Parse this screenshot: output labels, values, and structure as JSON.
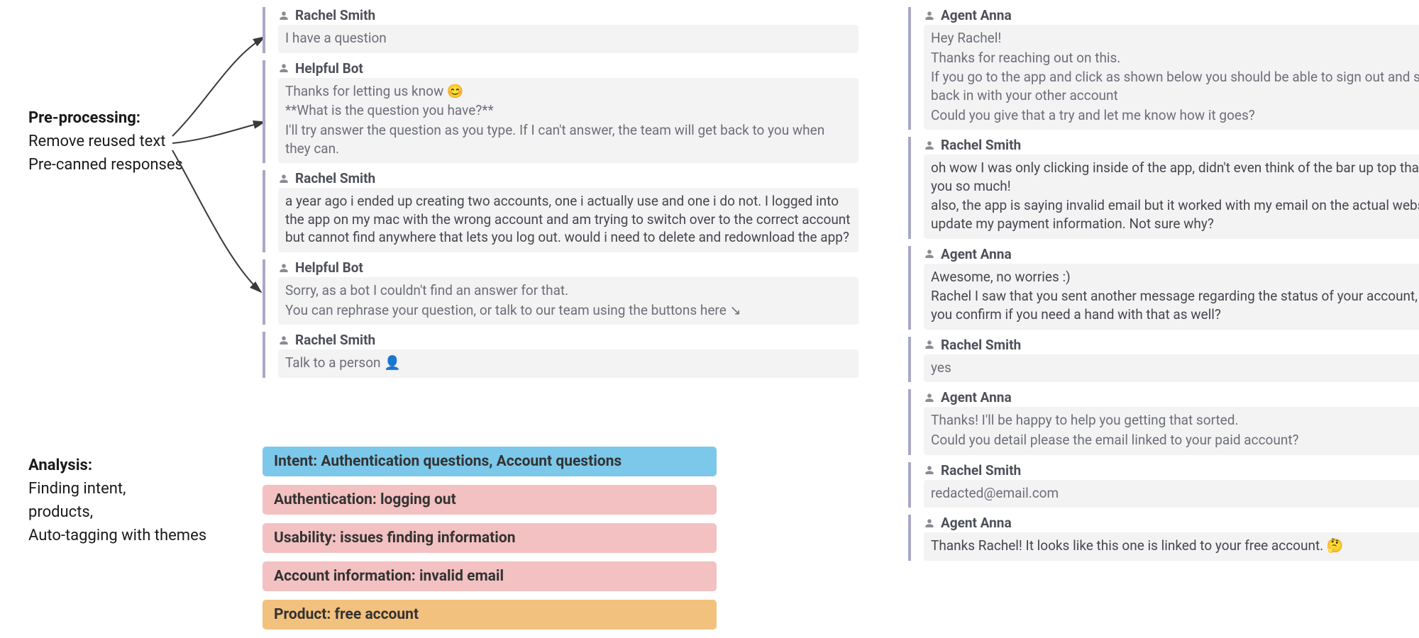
{
  "labels": {
    "preprocessing_title": "Pre-processing:",
    "preprocessing_line1": "Remove reused text",
    "preprocessing_line2": "Pre-canned responses",
    "analysis_title": "Analysis:",
    "analysis_line1": "Finding intent,",
    "analysis_line2": "products,",
    "analysis_line3": "Auto-tagging with themes"
  },
  "left_chat": [
    {
      "name": "Rachel Smith",
      "lines": [
        "I have a question"
      ],
      "dark": false
    },
    {
      "name": "Helpful Bot",
      "lines": [
        "Thanks for letting us know 😊",
        "**What is the question you have?**",
        "I'll try answer the question as you type. If I can't answer, the team will get back to you when they can."
      ],
      "dark": false
    },
    {
      "name": "Rachel Smith",
      "lines": [
        "a year ago i ended up creating two accounts, one i actually use and one i do not. I logged into the app on my mac with the wrong account and am trying to switch over to the correct account but cannot find anywhere that lets you log out. would i need to delete and redownload the app?"
      ],
      "dark": true
    },
    {
      "name": "Helpful Bot",
      "lines": [
        "Sorry, as a bot I couldn't find an answer for that.",
        "You can rephrase your question, or talk to our team using the buttons here ↘"
      ],
      "dark": false
    },
    {
      "name": "Rachel Smith",
      "lines": [
        "Talk to a person 👤"
      ],
      "dark": false
    }
  ],
  "right_chat": [
    {
      "name": "Agent Anna",
      "lines": [
        "Hey Rachel!",
        "Thanks for reaching out on this.",
        "If you go to the app and click as shown below you should be able to sign out and sign back in with your other account",
        "Could you give that a try and let me know how it goes?"
      ],
      "dark": false
    },
    {
      "name": "Rachel Smith",
      "lines": [
        "oh wow I was only clicking inside of the app, didn't even think of the bar up top thank you so much!",
        "also, the app is saying invalid email but it worked with my email on the actual website to update my payment information. Not sure why?"
      ],
      "dark": true
    },
    {
      "name": "Agent Anna",
      "lines": [
        "Awesome, no worries :)",
        "Rachel I saw that you sent another message regarding the status of your account, could you confirm if you need a hand with that as well?"
      ],
      "dark": true
    },
    {
      "name": "Rachel Smith",
      "lines": [
        "yes"
      ],
      "dark": false
    },
    {
      "name": "Agent Anna",
      "lines": [
        "Thanks! I'll be happy to help you getting that sorted.",
        "Could you detail please the email linked to your paid account?"
      ],
      "dark": false
    },
    {
      "name": "Rachel Smith",
      "lines": [
        "redacted@email.com"
      ],
      "dark": false
    },
    {
      "name": "Agent Anna",
      "lines": [
        "Thanks Rachel! It looks like this one is linked to your free account. 🤔"
      ],
      "dark": true
    }
  ],
  "tags": {
    "intent": "Intent: Authentication questions, Account questions",
    "authentication": "Authentication: logging out",
    "usability": "Usability: issues finding information",
    "account_info": "Account information: invalid email",
    "product": "Product: free account"
  }
}
